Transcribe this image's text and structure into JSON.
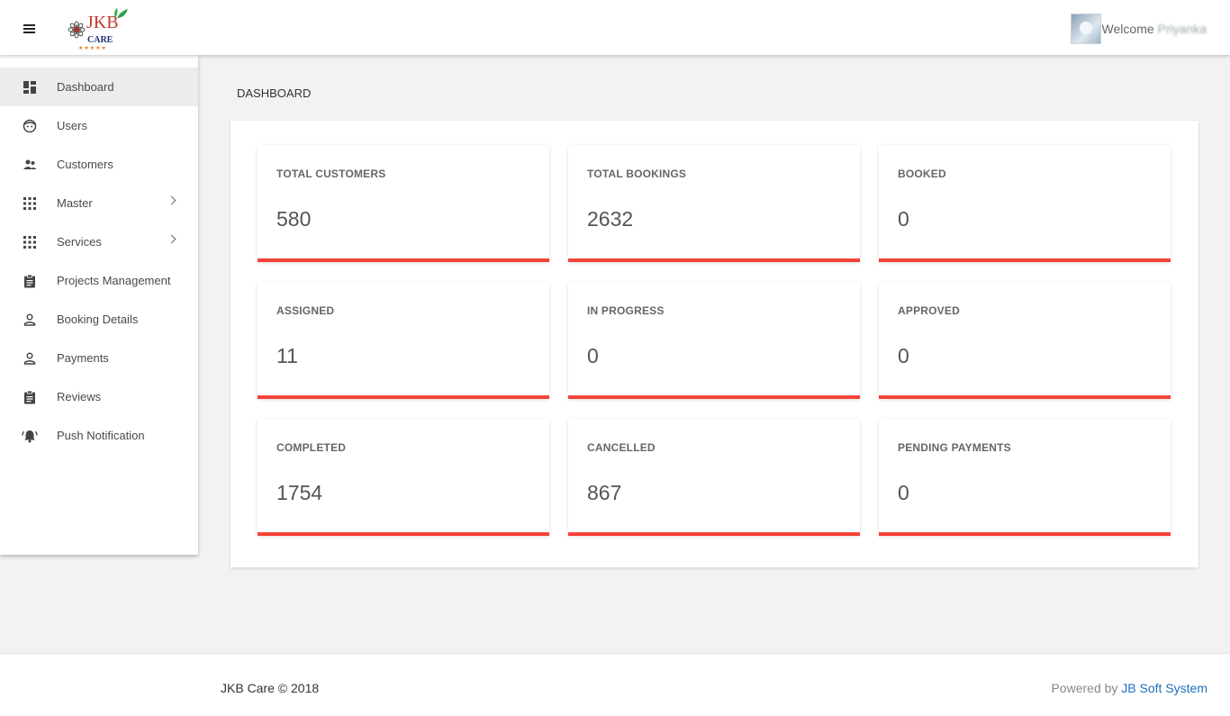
{
  "header": {
    "menu_icon": "hamburger-icon",
    "logo": {
      "text": "JKB",
      "subtext": "CARE",
      "stars": "★★★★★"
    },
    "welcome_label": "Welcome",
    "user_name": "Priyanka"
  },
  "sidebar": {
    "items": [
      {
        "label": "Dashboard",
        "icon": "dashboard-icon",
        "active": true
      },
      {
        "label": "Users",
        "icon": "face-icon"
      },
      {
        "label": "Customers",
        "icon": "people-icon"
      },
      {
        "label": "Master",
        "icon": "grid-icon",
        "has_submenu": true
      },
      {
        "label": "Services",
        "icon": "grid-icon",
        "has_submenu": true
      },
      {
        "label": "Projects Management",
        "icon": "clipboard-icon"
      },
      {
        "label": "Booking Details",
        "icon": "person-outline-icon"
      },
      {
        "label": "Payments",
        "icon": "person-outline-icon"
      },
      {
        "label": "Reviews",
        "icon": "clipboard-icon"
      },
      {
        "label": "Push Notification",
        "icon": "alarm-bell-icon"
      }
    ]
  },
  "main": {
    "title": "DASHBOARD",
    "accent_color": "#f44336",
    "cards": [
      {
        "label": "TOTAL CUSTOMERS",
        "value": "580"
      },
      {
        "label": "TOTAL BOOKINGS",
        "value": "2632"
      },
      {
        "label": "BOOKED",
        "value": "0"
      },
      {
        "label": "ASSIGNED",
        "value": "11"
      },
      {
        "label": "IN PROGRESS",
        "value": "0"
      },
      {
        "label": "APPROVED",
        "value": "0"
      },
      {
        "label": "COMPLETED",
        "value": "1754"
      },
      {
        "label": "CANCELLED",
        "value": "867"
      },
      {
        "label": "PENDING PAYMENTS",
        "value": "0"
      }
    ]
  },
  "footer": {
    "copyright": "JKB Care © 2018",
    "powered_label": "Powered by",
    "powered_link": "JB Soft System"
  }
}
